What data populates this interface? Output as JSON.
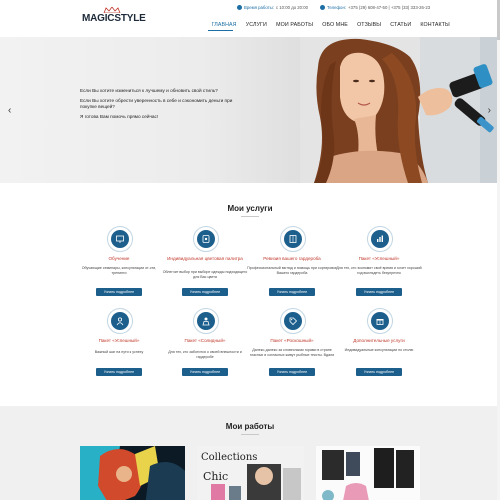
{
  "header": {
    "logo_text_1": "MAGIC",
    "logo_text_2": "STYLE",
    "hours_label": "Время работы:",
    "hours_value": "с 10:00 до 20:00",
    "phone_label": "Телефон:",
    "phone_value": "+375 (29) 608-47-50 | +375 (33) 333-26-23",
    "accent": "#1c6ea4"
  },
  "nav": {
    "items": [
      {
        "label": "ГЛАВНАЯ",
        "active": true
      },
      {
        "label": "УСЛУГИ",
        "active": false
      },
      {
        "label": "МОИ РАБОТЫ",
        "active": false
      },
      {
        "label": "ОБО МНЕ",
        "active": false
      },
      {
        "label": "ОТЗЫВЫ",
        "active": false
      },
      {
        "label": "СТАТЬИ",
        "active": false
      },
      {
        "label": "КОНТАКТЫ",
        "active": false
      }
    ]
  },
  "hero": {
    "line1": "Если Вы хотите измениться к лучшему и обновить свой стиль?",
    "line2": "Если Вы хотите обрести уверенность в себе и сэкономить деньги при покупке вещей?",
    "line3": "Я готова Вам помочь прямо сейчас!",
    "prev_arrow": "‹",
    "next_arrow": "›"
  },
  "services": {
    "title": "Мои услуги",
    "button_label": "Узнать подробнее",
    "items": [
      {
        "name": "Обучение",
        "desc": "Обучающие семинары, консультации от-сти, тренинги",
        "icon": "presentation-icon"
      },
      {
        "name": "Индивидуальная цветовая палитра",
        "desc": "Облегчит выбор при выборе одежды подходящего для Вас цвета",
        "icon": "palette-icon"
      },
      {
        "name": "Ревизия вашего гардероба",
        "desc": "Профессиональный взгляд и помощь при сортировке Вашего гардероба",
        "icon": "wardrobe-icon"
      },
      {
        "name": "Пакет «Успешный»",
        "desc": "Для тех, кто экономит своё время и хочет хороший гид выглядеть безупречно",
        "icon": "chart-icon"
      },
      {
        "name": "Пакет «Успешный»",
        "desc": "Важный шаг на пути к успеху",
        "icon": "person-icon"
      },
      {
        "name": "Пакет «Солидный»",
        "desc": "Для тех, кто заботится о своей внешности и гардеробе",
        "icon": "suit-icon"
      },
      {
        "name": "Пакет «Роскошный»",
        "desc": "Далеко-далеко за словесными горами в стране гласных и согласных живут рыбные тексты. Вдали",
        "icon": "tag-icon"
      },
      {
        "name": "Дополнительные услуги",
        "desc": "Индивидуальные консультации по стилю",
        "icon": "gift-icon"
      }
    ]
  },
  "works": {
    "title": "Мои работы",
    "thumb2_text": "Collections",
    "thumb2_text2": "Chic"
  }
}
